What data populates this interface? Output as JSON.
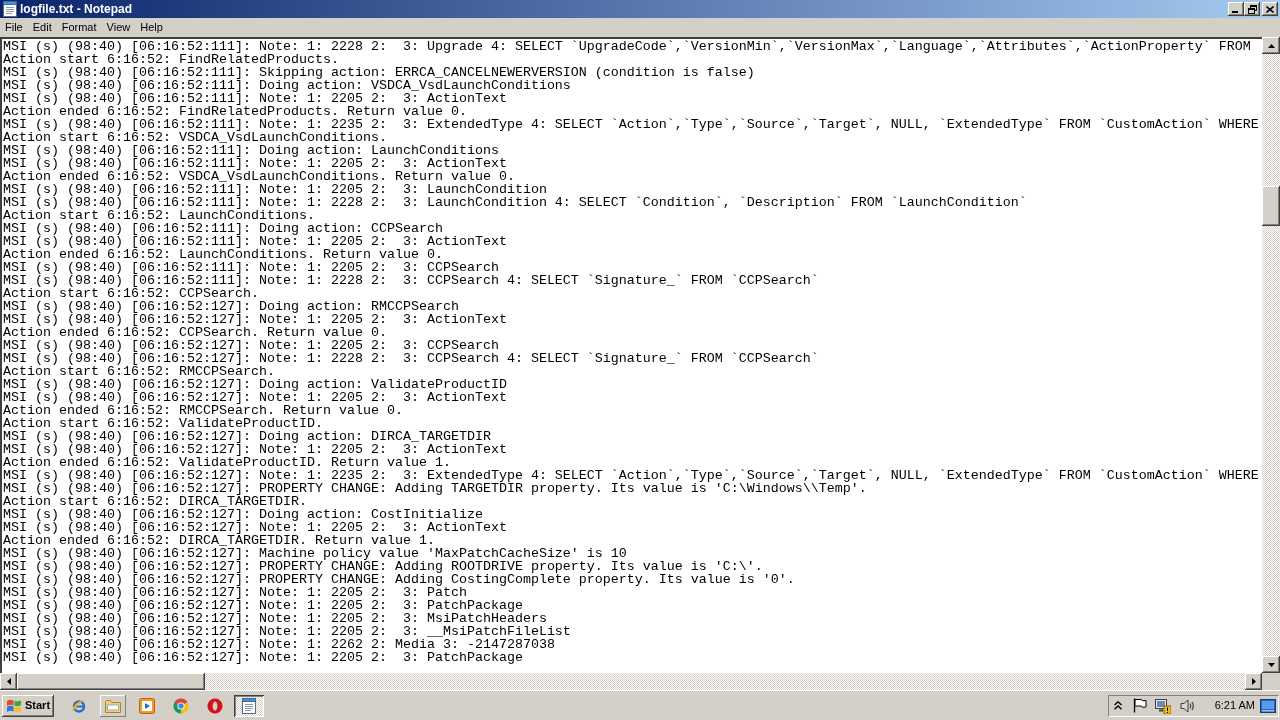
{
  "window": {
    "title": "logfile.txt - Notepad"
  },
  "menu": [
    "File",
    "Edit",
    "Format",
    "View",
    "Help"
  ],
  "document": {
    "lines": [
      "MSI (s) (98:40) [06:16:52:111]: Note: 1: 2228 2:  3: Upgrade 4: SELECT `UpgradeCode`,`VersionMin`,`VersionMax`,`Language`,`Attributes`,`ActionProperty` FROM",
      "Action start 6:16:52: FindRelatedProducts.",
      "MSI (s) (98:40) [06:16:52:111]: Skipping action: ERRCA_CANCELNEWERVERSION (condition is false)",
      "MSI (s) (98:40) [06:16:52:111]: Doing action: VSDCA_VsdLaunchConditions",
      "MSI (s) (98:40) [06:16:52:111]: Note: 1: 2205 2:  3: ActionText",
      "Action ended 6:16:52: FindRelatedProducts. Return value 0.",
      "MSI (s) (98:40) [06:16:52:111]: Note: 1: 2235 2:  3: ExtendedType 4: SELECT `Action`,`Type`,`Source`,`Target`, NULL, `ExtendedType` FROM `CustomAction` WHERE",
      "Action start 6:16:52: VSDCA_VsdLaunchConditions.",
      "MSI (s) (98:40) [06:16:52:111]: Doing action: LaunchConditions",
      "MSI (s) (98:40) [06:16:52:111]: Note: 1: 2205 2:  3: ActionText",
      "Action ended 6:16:52: VSDCA_VsdLaunchConditions. Return value 0.",
      "MSI (s) (98:40) [06:16:52:111]: Note: 1: 2205 2:  3: LaunchCondition",
      "MSI (s) (98:40) [06:16:52:111]: Note: 1: 2228 2:  3: LaunchCondition 4: SELECT `Condition`, `Description` FROM `LaunchCondition`",
      "Action start 6:16:52: LaunchConditions.",
      "MSI (s) (98:40) [06:16:52:111]: Doing action: CCPSearch",
      "MSI (s) (98:40) [06:16:52:111]: Note: 1: 2205 2:  3: ActionText",
      "Action ended 6:16:52: LaunchConditions. Return value 0.",
      "MSI (s) (98:40) [06:16:52:111]: Note: 1: 2205 2:  3: CCPSearch",
      "MSI (s) (98:40) [06:16:52:111]: Note: 1: 2228 2:  3: CCPSearch 4: SELECT `Signature_` FROM `CCPSearch`",
      "Action start 6:16:52: CCPSearch.",
      "MSI (s) (98:40) [06:16:52:127]: Doing action: RMCCPSearch",
      "MSI (s) (98:40) [06:16:52:127]: Note: 1: 2205 2:  3: ActionText",
      "Action ended 6:16:52: CCPSearch. Return value 0.",
      "MSI (s) (98:40) [06:16:52:127]: Note: 1: 2205 2:  3: CCPSearch",
      "MSI (s) (98:40) [06:16:52:127]: Note: 1: 2228 2:  3: CCPSearch 4: SELECT `Signature_` FROM `CCPSearch`",
      "Action start 6:16:52: RMCCPSearch.",
      "MSI (s) (98:40) [06:16:52:127]: Doing action: ValidateProductID",
      "MSI (s) (98:40) [06:16:52:127]: Note: 1: 2205 2:  3: ActionText",
      "Action ended 6:16:52: RMCCPSearch. Return value 0.",
      "Action start 6:16:52: ValidateProductID.",
      "MSI (s) (98:40) [06:16:52:127]: Doing action: DIRCA_TARGETDIR",
      "MSI (s) (98:40) [06:16:52:127]: Note: 1: 2205 2:  3: ActionText",
      "Action ended 6:16:52: ValidateProductID. Return value 1.",
      "MSI (s) (98:40) [06:16:52:127]: Note: 1: 2235 2:  3: ExtendedType 4: SELECT `Action`,`Type`,`Source`,`Target`, NULL, `ExtendedType` FROM `CustomAction` WHERE",
      "MSI (s) (98:40) [06:16:52:127]: PROPERTY CHANGE: Adding TARGETDIR property. Its value is 'C:\\Windows\\\\Temp'.",
      "Action start 6:16:52: DIRCA_TARGETDIR.",
      "MSI (s) (98:40) [06:16:52:127]: Doing action: CostInitialize",
      "MSI (s) (98:40) [06:16:52:127]: Note: 1: 2205 2:  3: ActionText",
      "Action ended 6:16:52: DIRCA_TARGETDIR. Return value 1.",
      "MSI (s) (98:40) [06:16:52:127]: Machine policy value 'MaxPatchCacheSize' is 10",
      "MSI (s) (98:40) [06:16:52:127]: PROPERTY CHANGE: Adding ROOTDRIVE property. Its value is 'C:\\'.",
      "MSI (s) (98:40) [06:16:52:127]: PROPERTY CHANGE: Adding CostingComplete property. Its value is '0'.",
      "MSI (s) (98:40) [06:16:52:127]: Note: 1: 2205 2:  3: Patch",
      "MSI (s) (98:40) [06:16:52:127]: Note: 1: 2205 2:  3: PatchPackage",
      "MSI (s) (98:40) [06:16:52:127]: Note: 1: 2205 2:  3: MsiPatchHeaders",
      "MSI (s) (98:40) [06:16:52:127]: Note: 1: 2205 2:  3: __MsiPatchFileList",
      "MSI (s) (98:40) [06:16:52:127]: Note: 1: 2262 2: Media 3: -2147287038",
      "MSI (s) (98:40) [06:16:52:127]: Note: 1: 2205 2:  3: PatchPackage"
    ]
  },
  "taskbar": {
    "start_label": "Start",
    "quick_launch": [
      {
        "kind": "orbit",
        "highlighted": false
      },
      {
        "kind": "folder",
        "highlighted": true
      },
      {
        "kind": "play",
        "highlighted": false
      },
      {
        "kind": "circle",
        "highlighted": false
      },
      {
        "kind": "ring",
        "highlighted": false
      }
    ],
    "windows": [
      {
        "kind": "notebook",
        "selected": true
      }
    ],
    "tray": [
      {
        "kind": "chevron"
      },
      {
        "kind": "flag"
      },
      {
        "kind": "monitor"
      },
      {
        "kind": "speaker"
      }
    ],
    "clock": "6:21 AM"
  }
}
